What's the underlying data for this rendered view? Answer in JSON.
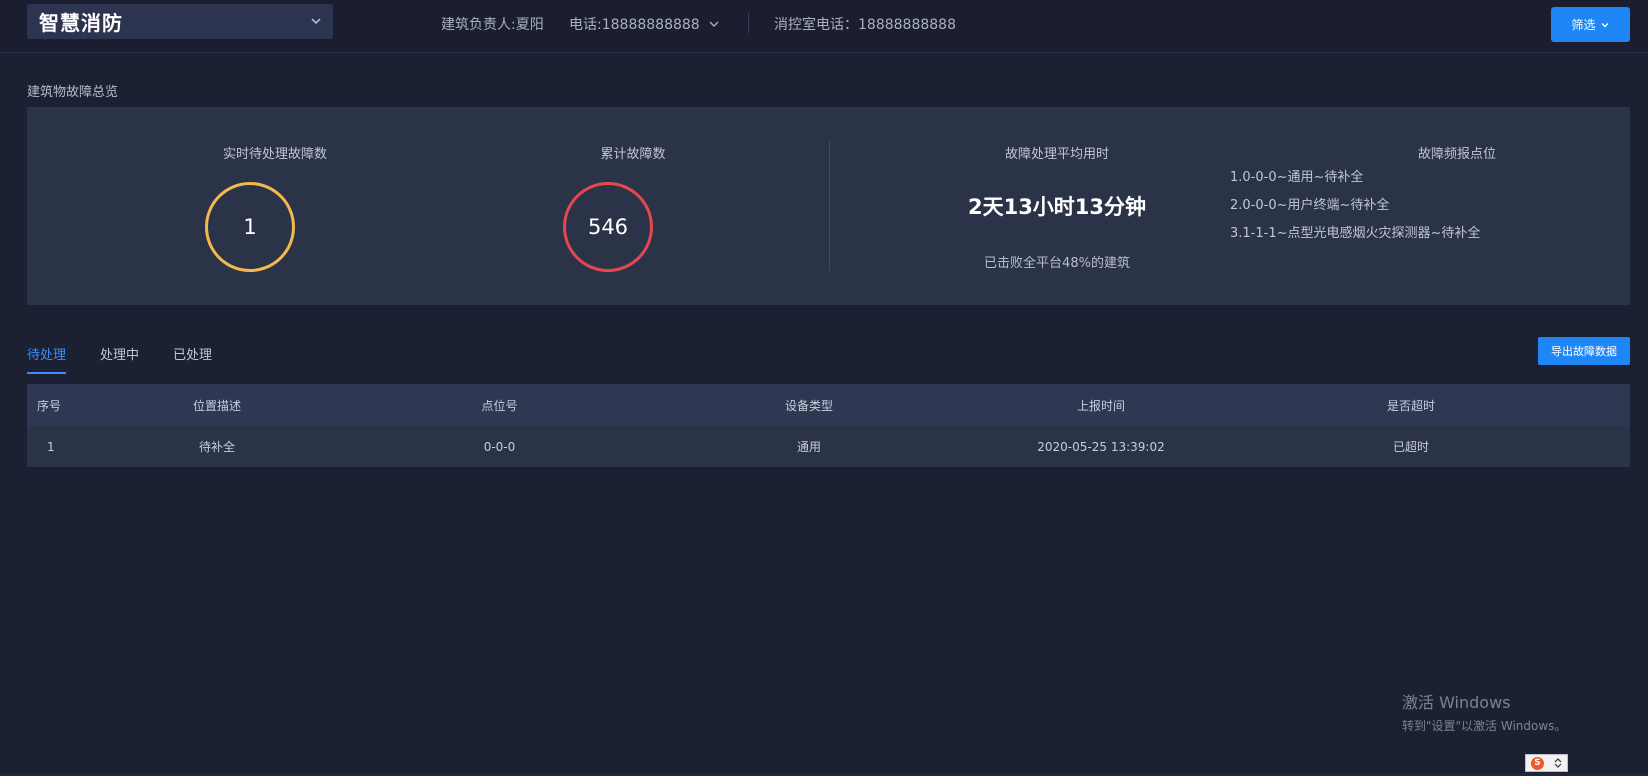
{
  "header": {
    "app_title": "智慧消防",
    "building_manager": "建筑负责人:夏阳",
    "phone": "电话:18888888888",
    "control_room_phone": "消控室电话：18888888888",
    "filter_label": "筛选"
  },
  "overview": {
    "section_title": "建筑物故障总览",
    "pending_label": "实时待处理故障数",
    "pending_value": "1",
    "total_label": "累计故障数",
    "total_value": "546",
    "avg_label": "故障处理平均用时",
    "avg_value": "2天13小时13分钟",
    "beat_text": "已击败全平台48%的建筑",
    "freq_label": "故障频报点位",
    "freq_items": [
      "1.0-0-0~通用~待补全",
      "2.0-0-0~用户终端~待补全",
      "3.1-1-1~点型光电感烟火灾探测器~待补全"
    ]
  },
  "tabs": [
    "待处理",
    "处理中",
    "已处理"
  ],
  "export_label": "导出故障数据",
  "table": {
    "headers": [
      "序号",
      "位置描述",
      "点位号",
      "设备类型",
      "上报时间",
      "是否超时"
    ],
    "rows": [
      [
        "1",
        "待补全",
        "0-0-0",
        "通用",
        "2020-05-25 13:39:02",
        "已超时"
      ]
    ]
  },
  "watermark": {
    "line1": "激活 Windows",
    "line2": "转到\"设置\"以激活 Windows。"
  },
  "ime_label": "S",
  "colors": {
    "accent": "#1f87f5",
    "ring_pending": "#f3b94f",
    "ring_total": "#e4484e",
    "panel": "#2b3349",
    "background": "#1c2033"
  }
}
